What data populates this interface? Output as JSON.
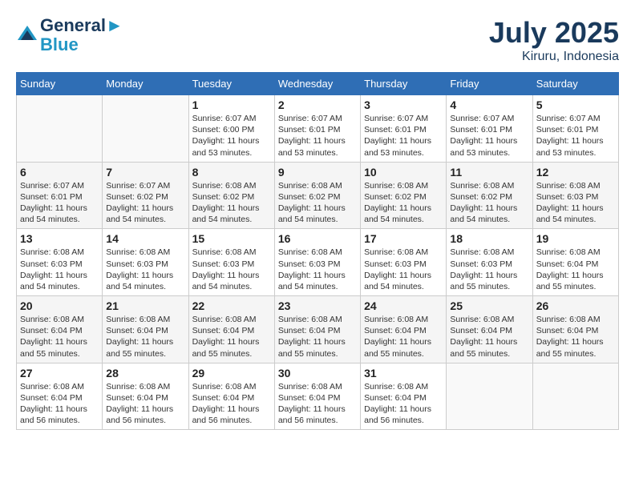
{
  "header": {
    "logo_line1": "General",
    "logo_line2": "Blue",
    "month": "July 2025",
    "location": "Kiruru, Indonesia"
  },
  "days_of_week": [
    "Sunday",
    "Monday",
    "Tuesday",
    "Wednesday",
    "Thursday",
    "Friday",
    "Saturday"
  ],
  "weeks": [
    [
      {
        "day": "",
        "sunrise": "",
        "sunset": "",
        "daylight": ""
      },
      {
        "day": "",
        "sunrise": "",
        "sunset": "",
        "daylight": ""
      },
      {
        "day": "1",
        "sunrise": "Sunrise: 6:07 AM",
        "sunset": "Sunset: 6:00 PM",
        "daylight": "Daylight: 11 hours and 53 minutes."
      },
      {
        "day": "2",
        "sunrise": "Sunrise: 6:07 AM",
        "sunset": "Sunset: 6:01 PM",
        "daylight": "Daylight: 11 hours and 53 minutes."
      },
      {
        "day": "3",
        "sunrise": "Sunrise: 6:07 AM",
        "sunset": "Sunset: 6:01 PM",
        "daylight": "Daylight: 11 hours and 53 minutes."
      },
      {
        "day": "4",
        "sunrise": "Sunrise: 6:07 AM",
        "sunset": "Sunset: 6:01 PM",
        "daylight": "Daylight: 11 hours and 53 minutes."
      },
      {
        "day": "5",
        "sunrise": "Sunrise: 6:07 AM",
        "sunset": "Sunset: 6:01 PM",
        "daylight": "Daylight: 11 hours and 53 minutes."
      }
    ],
    [
      {
        "day": "6",
        "sunrise": "Sunrise: 6:07 AM",
        "sunset": "Sunset: 6:01 PM",
        "daylight": "Daylight: 11 hours and 54 minutes."
      },
      {
        "day": "7",
        "sunrise": "Sunrise: 6:07 AM",
        "sunset": "Sunset: 6:02 PM",
        "daylight": "Daylight: 11 hours and 54 minutes."
      },
      {
        "day": "8",
        "sunrise": "Sunrise: 6:08 AM",
        "sunset": "Sunset: 6:02 PM",
        "daylight": "Daylight: 11 hours and 54 minutes."
      },
      {
        "day": "9",
        "sunrise": "Sunrise: 6:08 AM",
        "sunset": "Sunset: 6:02 PM",
        "daylight": "Daylight: 11 hours and 54 minutes."
      },
      {
        "day": "10",
        "sunrise": "Sunrise: 6:08 AM",
        "sunset": "Sunset: 6:02 PM",
        "daylight": "Daylight: 11 hours and 54 minutes."
      },
      {
        "day": "11",
        "sunrise": "Sunrise: 6:08 AM",
        "sunset": "Sunset: 6:02 PM",
        "daylight": "Daylight: 11 hours and 54 minutes."
      },
      {
        "day": "12",
        "sunrise": "Sunrise: 6:08 AM",
        "sunset": "Sunset: 6:03 PM",
        "daylight": "Daylight: 11 hours and 54 minutes."
      }
    ],
    [
      {
        "day": "13",
        "sunrise": "Sunrise: 6:08 AM",
        "sunset": "Sunset: 6:03 PM",
        "daylight": "Daylight: 11 hours and 54 minutes."
      },
      {
        "day": "14",
        "sunrise": "Sunrise: 6:08 AM",
        "sunset": "Sunset: 6:03 PM",
        "daylight": "Daylight: 11 hours and 54 minutes."
      },
      {
        "day": "15",
        "sunrise": "Sunrise: 6:08 AM",
        "sunset": "Sunset: 6:03 PM",
        "daylight": "Daylight: 11 hours and 54 minutes."
      },
      {
        "day": "16",
        "sunrise": "Sunrise: 6:08 AM",
        "sunset": "Sunset: 6:03 PM",
        "daylight": "Daylight: 11 hours and 54 minutes."
      },
      {
        "day": "17",
        "sunrise": "Sunrise: 6:08 AM",
        "sunset": "Sunset: 6:03 PM",
        "daylight": "Daylight: 11 hours and 54 minutes."
      },
      {
        "day": "18",
        "sunrise": "Sunrise: 6:08 AM",
        "sunset": "Sunset: 6:03 PM",
        "daylight": "Daylight: 11 hours and 55 minutes."
      },
      {
        "day": "19",
        "sunrise": "Sunrise: 6:08 AM",
        "sunset": "Sunset: 6:04 PM",
        "daylight": "Daylight: 11 hours and 55 minutes."
      }
    ],
    [
      {
        "day": "20",
        "sunrise": "Sunrise: 6:08 AM",
        "sunset": "Sunset: 6:04 PM",
        "daylight": "Daylight: 11 hours and 55 minutes."
      },
      {
        "day": "21",
        "sunrise": "Sunrise: 6:08 AM",
        "sunset": "Sunset: 6:04 PM",
        "daylight": "Daylight: 11 hours and 55 minutes."
      },
      {
        "day": "22",
        "sunrise": "Sunrise: 6:08 AM",
        "sunset": "Sunset: 6:04 PM",
        "daylight": "Daylight: 11 hours and 55 minutes."
      },
      {
        "day": "23",
        "sunrise": "Sunrise: 6:08 AM",
        "sunset": "Sunset: 6:04 PM",
        "daylight": "Daylight: 11 hours and 55 minutes."
      },
      {
        "day": "24",
        "sunrise": "Sunrise: 6:08 AM",
        "sunset": "Sunset: 6:04 PM",
        "daylight": "Daylight: 11 hours and 55 minutes."
      },
      {
        "day": "25",
        "sunrise": "Sunrise: 6:08 AM",
        "sunset": "Sunset: 6:04 PM",
        "daylight": "Daylight: 11 hours and 55 minutes."
      },
      {
        "day": "26",
        "sunrise": "Sunrise: 6:08 AM",
        "sunset": "Sunset: 6:04 PM",
        "daylight": "Daylight: 11 hours and 55 minutes."
      }
    ],
    [
      {
        "day": "27",
        "sunrise": "Sunrise: 6:08 AM",
        "sunset": "Sunset: 6:04 PM",
        "daylight": "Daylight: 11 hours and 56 minutes."
      },
      {
        "day": "28",
        "sunrise": "Sunrise: 6:08 AM",
        "sunset": "Sunset: 6:04 PM",
        "daylight": "Daylight: 11 hours and 56 minutes."
      },
      {
        "day": "29",
        "sunrise": "Sunrise: 6:08 AM",
        "sunset": "Sunset: 6:04 PM",
        "daylight": "Daylight: 11 hours and 56 minutes."
      },
      {
        "day": "30",
        "sunrise": "Sunrise: 6:08 AM",
        "sunset": "Sunset: 6:04 PM",
        "daylight": "Daylight: 11 hours and 56 minutes."
      },
      {
        "day": "31",
        "sunrise": "Sunrise: 6:08 AM",
        "sunset": "Sunset: 6:04 PM",
        "daylight": "Daylight: 11 hours and 56 minutes."
      },
      {
        "day": "",
        "sunrise": "",
        "sunset": "",
        "daylight": ""
      },
      {
        "day": "",
        "sunrise": "",
        "sunset": "",
        "daylight": ""
      }
    ]
  ]
}
